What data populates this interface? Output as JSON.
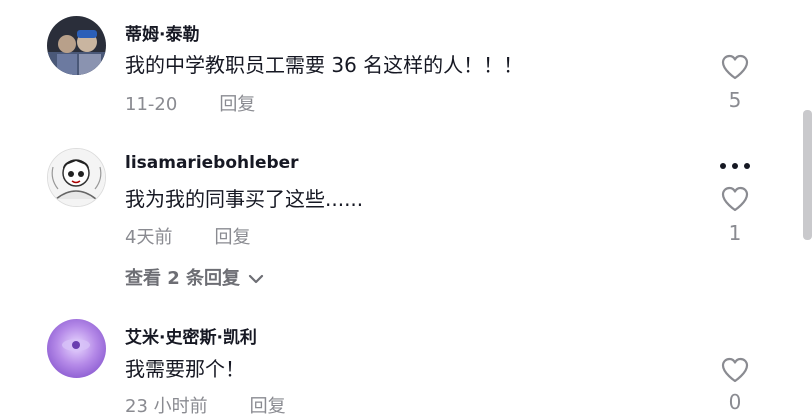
{
  "comments": [
    {
      "username": "蒂姆·泰勒",
      "text": "我的中学教职员工需要 36 名这样的人！！！",
      "date": "11-20",
      "reply_label": "回复",
      "likes": "5",
      "avatar": "photo-avatar-icon"
    },
    {
      "username": "lisamariebohleber",
      "text": "我为我的同事买了这些......",
      "date": "4天前",
      "reply_label": "回复",
      "likes": "1",
      "view_replies": "查看 2 条回复",
      "avatar": "cartoon-avatar-icon"
    },
    {
      "username": "艾米·史密斯·凯利",
      "text": "我需要那个！",
      "date": "23 小时前",
      "reply_label": "回复",
      "likes": "0",
      "avatar": "purple-avatar-icon"
    }
  ],
  "colors": {
    "primary_text": "#161823",
    "secondary_text": "#8a8b91"
  }
}
